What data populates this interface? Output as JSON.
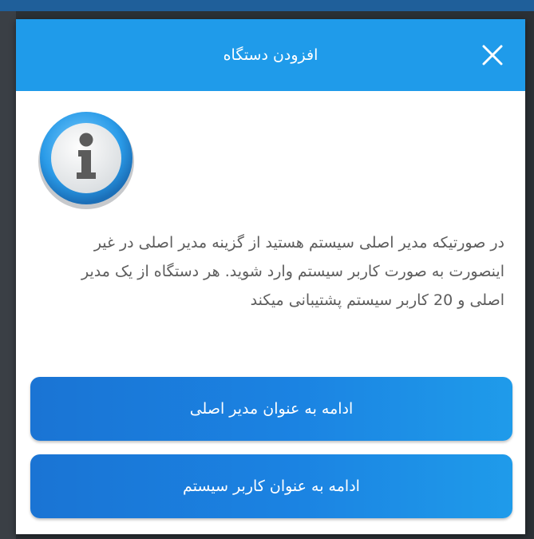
{
  "dialog": {
    "title": "افزودن دستگاه",
    "message": "در صورتیکه مدیر اصلی سیستم هستید از گزینه مدیر اصلی در غیر اینصورت به صورت کاربر سیستم وارد شوید. هر دستگاه از یک مدیر اصلی و 20 کاربر سیستم پشتیبانی میکند",
    "primary_admin_button": "ادامه به عنوان مدیر اصلی",
    "system_user_button": "ادامه به عنوان کاربر سیستم",
    "close_icon": "close-icon",
    "info_icon": "info-icon"
  },
  "colors": {
    "header": "#1f9bea",
    "button_start": "#1a74d4",
    "button_end": "#1f9bea",
    "message_text": "#5d5d5d"
  }
}
